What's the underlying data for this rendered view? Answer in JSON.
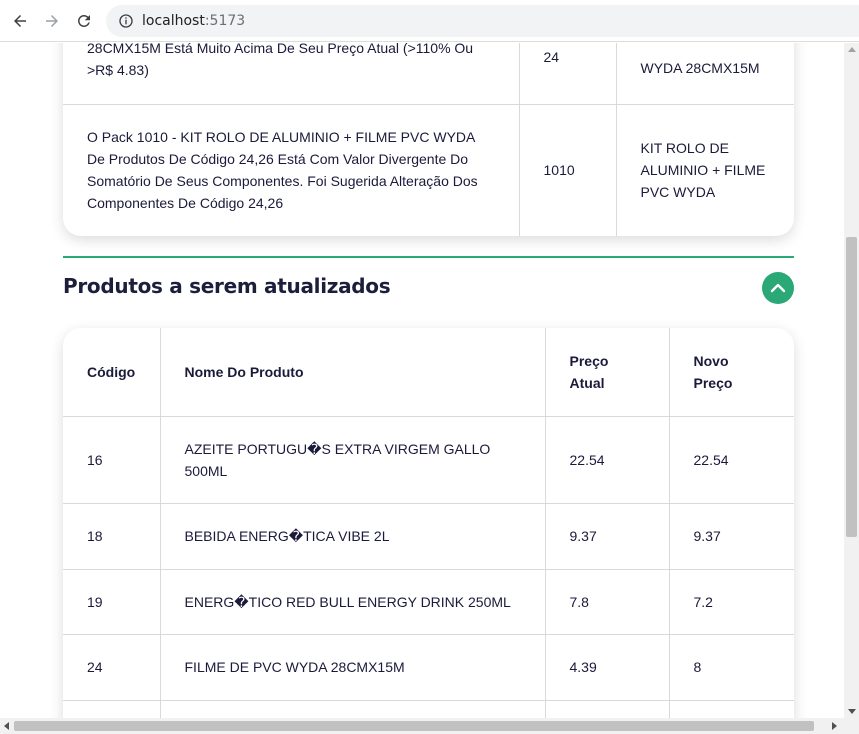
{
  "browser": {
    "url_host": "localhost",
    "url_port": ":5173",
    "back_icon": "arrow-left-icon",
    "forward_icon": "arrow-right-icon",
    "reload_icon": "reload-icon",
    "info_icon": "info-icon"
  },
  "alerts": {
    "rows": [
      {
        "message": "28CMX15M Está Muito Acima De Seu Preço Atual (>110% Ou >R$ 4.83)",
        "code": "24",
        "product": "WYDA 28CMX15M"
      },
      {
        "message": "O Pack 1010 - KIT ROLO DE ALUMINIO + FILME PVC WYDA De Produtos De Código 24,26 Está Com Valor Divergente Do Somatório De Seus Componentes. Foi Sugerida Alteração Dos Componentes De Código 24,26",
        "code": "1010",
        "product": "KIT ROLO DE ALUMINIO + FILME PVC WYDA"
      }
    ]
  },
  "section": {
    "title": "Produtos a serem atualizados",
    "toggle_icon": "chevron-up-icon",
    "accent_color": "#2aa876"
  },
  "products": {
    "headers": {
      "code": "Código",
      "name": "Nome Do Produto",
      "current_price": "Preço Atual",
      "new_price": "Novo Preço"
    },
    "rows": [
      {
        "code": "16",
        "name": "AZEITE PORTUGU�S EXTRA VIRGEM GALLO 500ML",
        "current_price": "22.54",
        "new_price": "22.54"
      },
      {
        "code": "18",
        "name": "BEBIDA ENERG�TICA VIBE 2L",
        "current_price": "9.37",
        "new_price": "9.37"
      },
      {
        "code": "19",
        "name": "ENERG�TICO RED BULL ENERGY DRINK 250ML",
        "current_price": "7.8",
        "new_price": "7.2"
      },
      {
        "code": "24",
        "name": "FILME DE PVC WYDA 28CMX15M",
        "current_price": "4.39",
        "new_price": "8"
      },
      {
        "code": "",
        "name": "",
        "current_price": "",
        "new_price": ""
      }
    ]
  }
}
